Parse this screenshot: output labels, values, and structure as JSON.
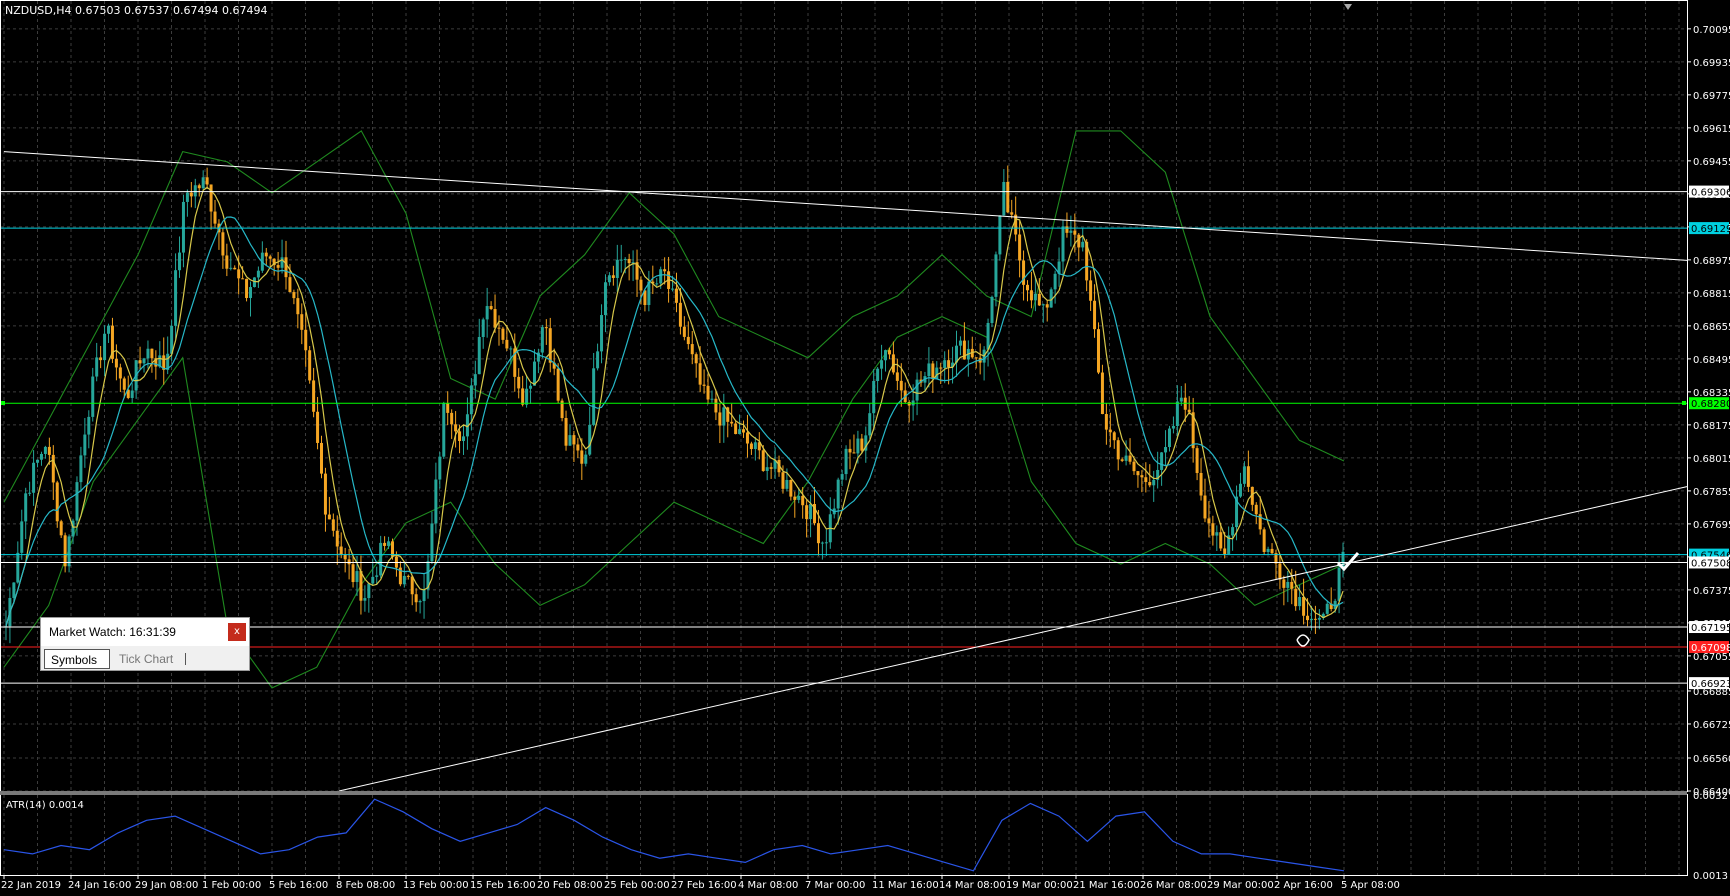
{
  "header": {
    "symbol": "NZDUSD,H4",
    "ohlc": "0.67503 0.67537 0.67494 0.67494",
    "atr_label": "ATR(14) 0.0014"
  },
  "market_watch": {
    "title": "Market Watch: 16:31:39",
    "close_label": "x",
    "tabs": [
      "Symbols",
      "Tick Chart"
    ]
  },
  "colors": {
    "background": "#000000",
    "grid": "#3c3c3c",
    "bull_candle": "#26a69a",
    "bear_candle": "#f5a623",
    "bollinger": "#1f8a1f",
    "ma_yellow": "#d8c84a",
    "ma_cyan": "#26b8c8",
    "atr_line": "#2a55e8",
    "cyan_level": "#00d0e0",
    "green_level": "#00ff00",
    "red_level": "#ff2020",
    "white_level": "#ffffff"
  },
  "chart_data": {
    "type": "candlestick",
    "symbol": "NZDUSD",
    "timeframe": "H4",
    "ylim": [
      0.664,
      0.7023
    ],
    "y_ticks": [
      "0.70095",
      "0.69935",
      "0.69775",
      "0.69615",
      "0.69455",
      "0.69295",
      "0.69135",
      "0.68975",
      "0.68815",
      "0.68655",
      "0.68495",
      "0.68335",
      "0.68175",
      "0.68015",
      "0.67855",
      "0.67695",
      "0.67535",
      "0.67375",
      "0.67215",
      "0.67055",
      "0.66885",
      "0.66725",
      "0.66560",
      "0.66400"
    ],
    "x_ticks": [
      "22 Jan 2019",
      "24 Jan 16:00",
      "29 Jan 08:00",
      "1 Feb 00:00",
      "5 Feb 16:00",
      "8 Feb 08:00",
      "13 Feb 00:00",
      "15 Feb 16:00",
      "20 Feb 08:00",
      "25 Feb 00:00",
      "27 Feb 16:00",
      "4 Mar 08:00",
      "7 Mar 00:00",
      "11 Mar 16:00",
      "14 Mar 08:00",
      "19 Mar 00:00",
      "21 Mar 16:00",
      "26 Mar 08:00",
      "29 Mar 00:00",
      "2 Apr 16:00",
      "5 Apr 08:00"
    ],
    "close_path": [
      0.672,
      0.6785,
      0.681,
      0.675,
      0.682,
      0.6865,
      0.683,
      0.6855,
      0.6845,
      0.693,
      0.6935,
      0.69,
      0.688,
      0.69,
      0.6895,
      0.685,
      0.678,
      0.675,
      0.6735,
      0.676,
      0.674,
      0.6735,
      0.683,
      0.681,
      0.688,
      0.686,
      0.683,
      0.687,
      0.681,
      0.68,
      0.689,
      0.69,
      0.688,
      0.689,
      0.686,
      0.683,
      0.682,
      0.681,
      0.68,
      0.679,
      0.678,
      0.676,
      0.68,
      0.681,
      0.686,
      0.683,
      0.684,
      0.685,
      0.6855,
      0.685,
      0.693,
      0.689,
      0.687,
      0.691,
      0.6905,
      0.682,
      0.68,
      0.679,
      0.68,
      0.6835,
      0.678,
      0.675,
      0.68,
      0.676,
      0.6745,
      0.673,
      0.672,
      0.675
    ],
    "bollinger_upper": [
      0.678,
      0.682,
      0.686,
      0.69,
      0.695,
      0.6945,
      0.693,
      0.6945,
      0.696,
      0.692,
      0.684,
      0.683,
      0.688,
      0.69,
      0.693,
      0.691,
      0.687,
      0.686,
      0.685,
      0.687,
      0.688,
      0.69,
      0.688,
      0.687,
      0.696,
      0.696,
      0.694,
      0.687,
      0.684,
      0.681,
      0.68
    ],
    "bollinger_lower": [
      0.67,
      0.673,
      0.679,
      0.682,
      0.685,
      0.672,
      0.669,
      0.67,
      0.674,
      0.677,
      0.678,
      0.675,
      0.673,
      0.674,
      0.676,
      0.678,
      0.677,
      0.676,
      0.679,
      0.683,
      0.686,
      0.687,
      0.686,
      0.679,
      0.676,
      0.675,
      0.676,
      0.675,
      0.673,
      0.674,
      0.675
    ],
    "levels": [
      {
        "price": 0.69306,
        "label": "0.69306",
        "color": "white"
      },
      {
        "price": 0.69129,
        "label": "0.69129",
        "color": "cyan"
      },
      {
        "price": 0.6828,
        "label": "0.68280",
        "color": "green"
      },
      {
        "price": 0.67546,
        "label": "0.67546",
        "color": "cyan"
      },
      {
        "price": 0.67508,
        "label": "0.67508",
        "color": "white"
      },
      {
        "price": 0.67195,
        "label": "0.67195",
        "color": "white"
      },
      {
        "price": 0.67098,
        "label": "0.67098",
        "color": "red"
      },
      {
        "price": 0.66923,
        "label": "0.66923",
        "color": "white"
      }
    ],
    "trendlines": [
      {
        "from": [
          "22 Jan 2019",
          0.695
        ],
        "to": [
          "5 Apr 08:00",
          0.6908
        ],
        "color": "white"
      },
      {
        "from": [
          "8 Feb 08:00",
          0.664
        ],
        "to": [
          "5 Apr 08:00",
          0.675
        ],
        "color": "white"
      }
    ],
    "atr": {
      "ylim": [
        0.0013,
        0.0032
      ],
      "y_ticks": [
        "0.0032",
        "0.0013"
      ],
      "values": [
        0.0019,
        0.0018,
        0.002,
        0.0019,
        0.0023,
        0.0026,
        0.0027,
        0.0024,
        0.0021,
        0.0018,
        0.0019,
        0.0022,
        0.0023,
        0.0031,
        0.0028,
        0.0024,
        0.0021,
        0.0023,
        0.0025,
        0.0029,
        0.0026,
        0.0022,
        0.0019,
        0.0017,
        0.0018,
        0.0017,
        0.0016,
        0.0019,
        0.002,
        0.0018,
        0.0019,
        0.002,
        0.0018,
        0.0016,
        0.0014,
        0.0026,
        0.003,
        0.0027,
        0.0021,
        0.0027,
        0.0028,
        0.0021,
        0.0018,
        0.0018,
        0.0017,
        0.0016,
        0.0015,
        0.0014
      ]
    }
  }
}
